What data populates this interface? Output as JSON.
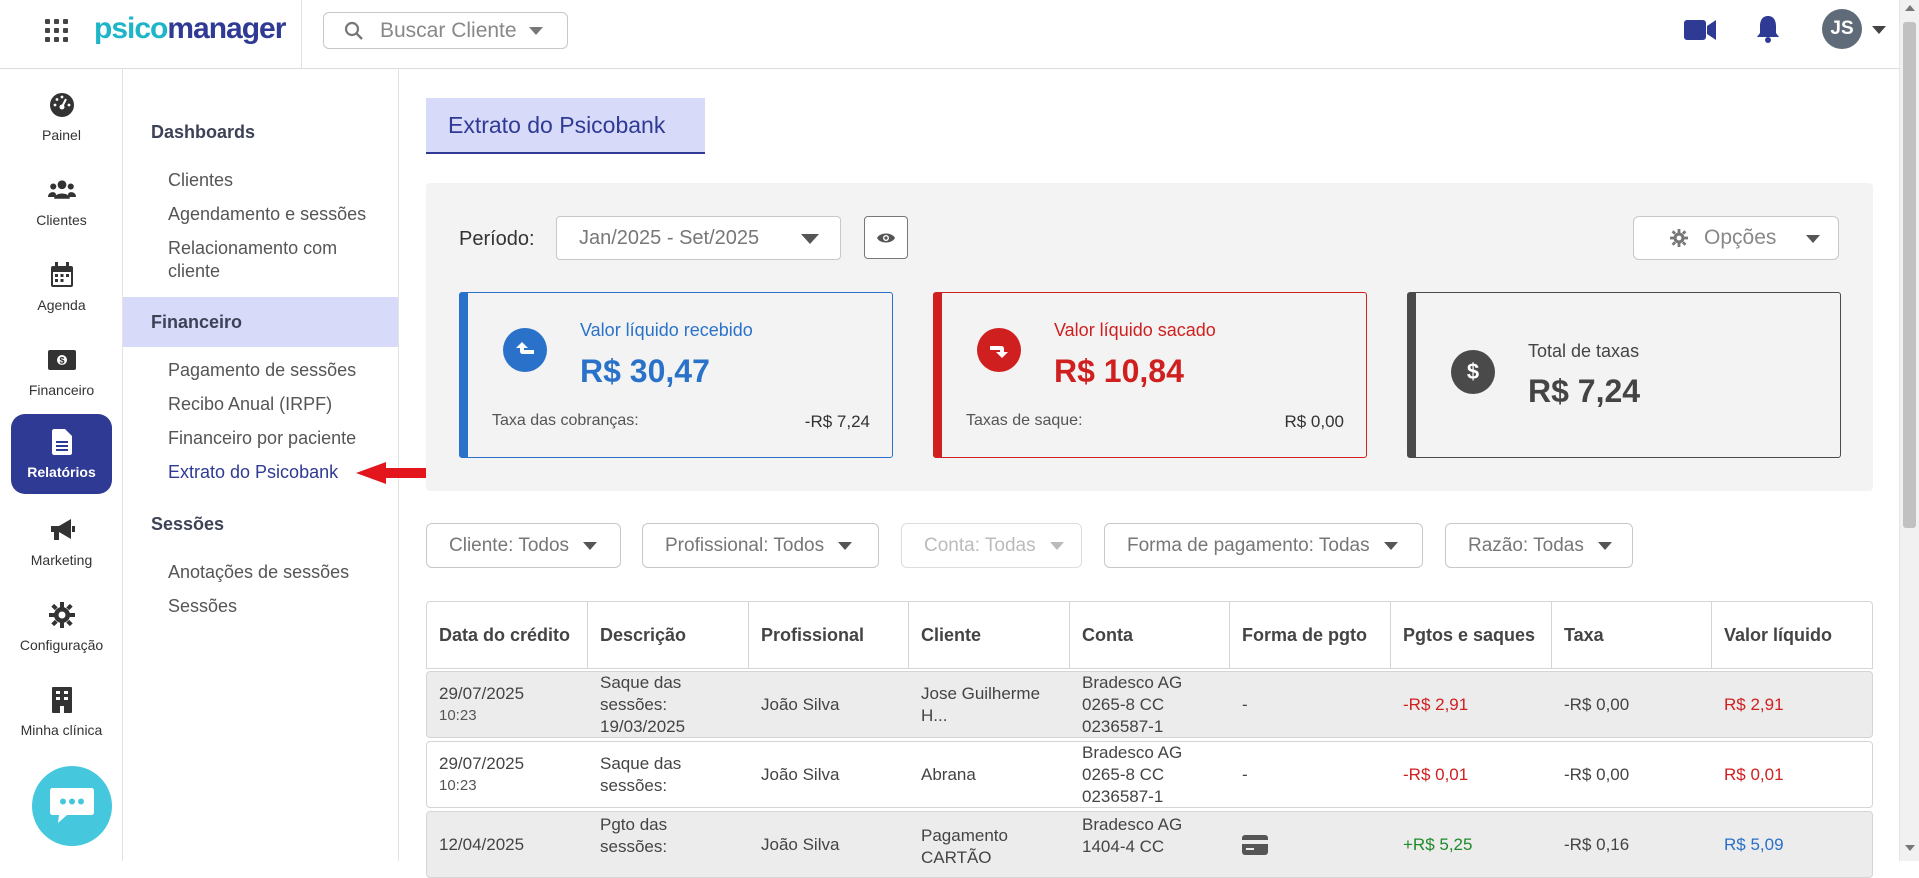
{
  "header": {
    "logo_part1": "psico",
    "logo_part2": "manager",
    "search_placeholder": "Buscar Cliente",
    "avatar_initials": "JS"
  },
  "rail": {
    "items": [
      {
        "label": "Painel",
        "icon": "dashboard-gauge-icon"
      },
      {
        "label": "Clientes",
        "icon": "users-icon"
      },
      {
        "label": "Agenda",
        "icon": "calendar-icon"
      },
      {
        "label": "Financeiro",
        "icon": "money-bill-icon"
      },
      {
        "label": "Relatórios",
        "icon": "document-icon",
        "active": true
      },
      {
        "label": "Marketing",
        "icon": "megaphone-icon"
      },
      {
        "label": "Configuração",
        "icon": "gear-icon"
      },
      {
        "label": "Minha clínica",
        "icon": "building-icon"
      }
    ]
  },
  "submenu": {
    "sections": [
      {
        "title": "Dashboards",
        "items": [
          "Clientes",
          "Agendamento e sessões",
          "Relacionamento com cliente"
        ]
      },
      {
        "title": "Financeiro",
        "items": [
          "Pagamento de sessões",
          "Recibo Anual (IRPF)",
          "Financeiro por paciente",
          "Extrato do Psicobank"
        ]
      },
      {
        "title": "Sessões",
        "items": [
          "Anotações de sessões",
          "Sessões"
        ]
      }
    ],
    "active_item": "Extrato do Psicobank"
  },
  "page": {
    "title": "Extrato do Psicobank",
    "periodo_label": "Período:",
    "periodo_value": "Jan/2025 - Set/2025",
    "opcoes_label": "Opções"
  },
  "cards": [
    {
      "title": "Valor líquido recebido",
      "value": "R$ 30,47",
      "fee_label": "Taxa das cobranças:",
      "fee_value": "-R$ 7,24",
      "color": "#2a72c9"
    },
    {
      "title": "Valor líquido sacado",
      "value": "R$ 10,84",
      "fee_label": "Taxas de saque:",
      "fee_value": "R$ 0,00",
      "color": "#d01f1f"
    },
    {
      "title": "Total de taxas",
      "value": "R$ 7,24",
      "color": "#4a4a4a"
    }
  ],
  "filters": [
    {
      "label": "Cliente: Todos"
    },
    {
      "label": "Profissional: Todos"
    },
    {
      "label": "Conta: Todas",
      "disabled": true
    },
    {
      "label": "Forma de pagamento: Todas"
    },
    {
      "label": "Razão: Todas"
    }
  ],
  "table": {
    "columns": [
      "Data do crédito",
      "Descrição",
      "Profissional",
      "Cliente",
      "Conta",
      "Forma de pgto",
      "Pgtos e saques",
      "Taxa",
      "Valor líquido"
    ],
    "rows": [
      {
        "date": "29/07/2025",
        "time": "10:23",
        "descricao": [
          "Saque das",
          "sessões:",
          "19/03/2025"
        ],
        "profissional": "João Silva",
        "cliente": [
          "Jose Guilherme",
          "H..."
        ],
        "conta": [
          "Bradesco AG",
          "0265-8 CC",
          "0236587-1"
        ],
        "forma": "-",
        "pgtos": "-R$ 2,91",
        "taxa": "-R$ 0,00",
        "liquido": "R$ 2,91",
        "kind": "saque"
      },
      {
        "date": "29/07/2025",
        "time": "10:23",
        "descricao": [
          "Saque das",
          "sessões:"
        ],
        "profissional": "João Silva",
        "cliente": [
          "Abrana"
        ],
        "conta": [
          "Bradesco AG",
          "0265-8 CC",
          "0236587-1"
        ],
        "forma": "-",
        "pgtos": "-R$ 0,01",
        "taxa": "-R$ 0,00",
        "liquido": "R$ 0,01",
        "kind": "saque"
      },
      {
        "date": "12/04/2025",
        "time": "",
        "descricao": [
          "Pgto das",
          "sessões:"
        ],
        "profissional": "João Silva",
        "cliente": [
          "Pagamento",
          "CARTÃO"
        ],
        "conta": [
          "Bradesco AG",
          "1404-4 CC"
        ],
        "forma": "card-icon",
        "pgtos": "+R$ 5,25",
        "taxa": "-R$ 0,16",
        "liquido": "R$ 5,09",
        "kind": "pgto"
      }
    ]
  }
}
